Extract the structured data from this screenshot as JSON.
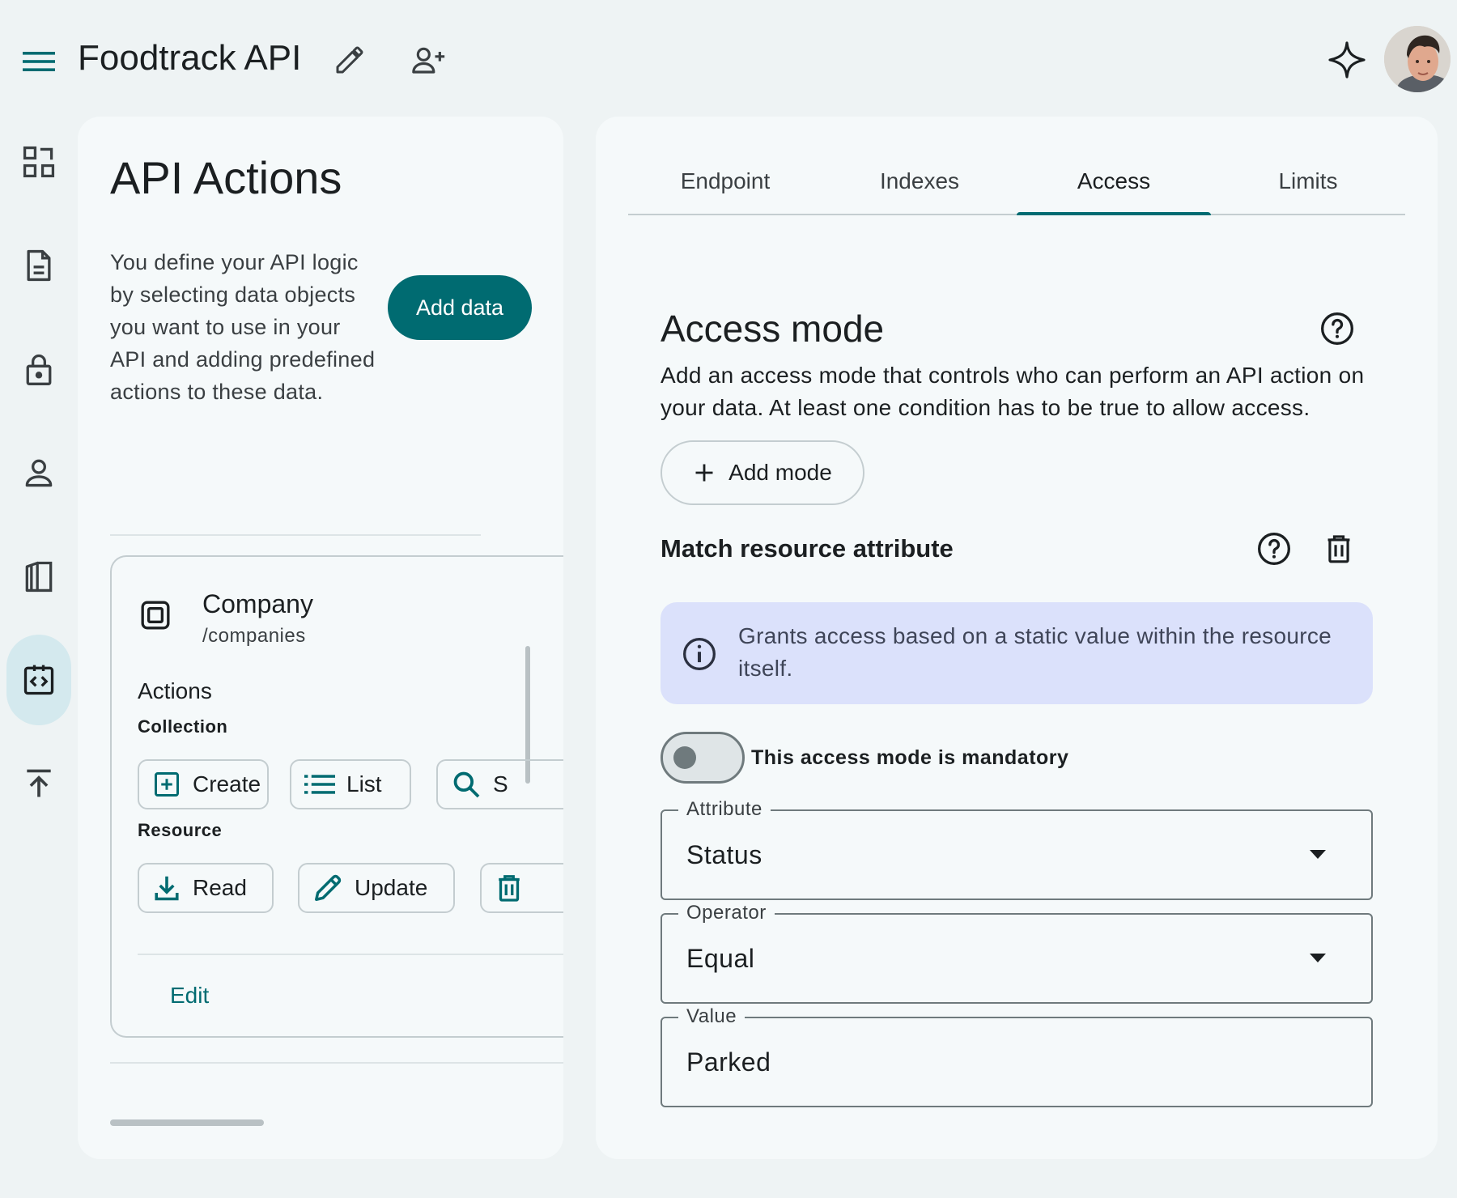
{
  "header": {
    "title": "Foodtrack API",
    "icons": {
      "menu": "menu-icon",
      "edit": "pencil-icon",
      "share": "person-add-icon",
      "assistant": "sparkle-icon",
      "avatar": "user-avatar"
    }
  },
  "rail": {
    "items": [
      {
        "name": "dashboard-icon"
      },
      {
        "name": "document-icon"
      },
      {
        "name": "lock-icon"
      },
      {
        "name": "person-icon"
      },
      {
        "name": "book-icon"
      },
      {
        "name": "api-code-icon",
        "active": true
      },
      {
        "name": "upload-icon"
      }
    ]
  },
  "left_panel": {
    "title": "API Actions",
    "description": "You define your API logic by selecting data objects you want to use in your API and adding predefined actions to these data.",
    "add_data_label": "Add data",
    "card": {
      "name": "Company",
      "path": "/companies",
      "actions_title": "Actions",
      "collection_label": "Collection",
      "collection_actions": [
        "Create",
        "List",
        "S"
      ],
      "resource_label": "Resource",
      "resource_actions": [
        "Read",
        "Update"
      ],
      "edit_label": "Edit"
    }
  },
  "right_panel": {
    "tabs": [
      {
        "label": "Endpoint"
      },
      {
        "label": "Indexes"
      },
      {
        "label": "Access",
        "active": true
      },
      {
        "label": "Limits"
      }
    ],
    "access_mode": {
      "title": "Access mode",
      "description": "Add an access mode that controls who can perform an API action on your data. At least one condition has to be true to allow access.",
      "add_mode_label": "Add mode"
    },
    "match": {
      "title": "Match resource attribute",
      "info": "Grants access based on a static value within the resource itself.",
      "mandatory_label": "This access mode is mandatory",
      "mandatory": false,
      "fields": {
        "attribute": {
          "label": "Attribute",
          "value": "Status"
        },
        "operator": {
          "label": "Operator",
          "value": "Equal"
        },
        "value": {
          "label": "Value",
          "value": "Parked"
        }
      }
    }
  },
  "colors": {
    "accent": "#006b71",
    "background": "#eef3f4",
    "panel": "#f5f9fa",
    "info_bg": "#dbe1fb",
    "rail_active": "#d4e9ee"
  }
}
